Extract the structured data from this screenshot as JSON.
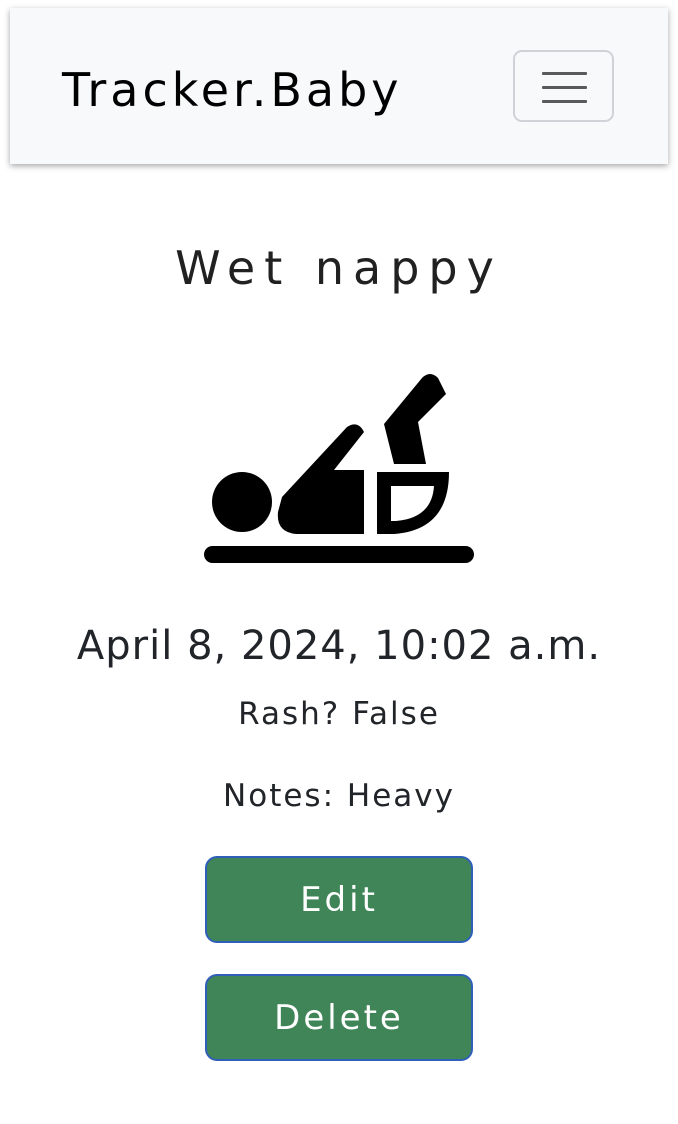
{
  "navbar": {
    "brand": "Tracker.Baby",
    "menu_icon": "hamburger-menu-icon"
  },
  "entry": {
    "title": "Wet nappy",
    "icon": "baby-changing-icon",
    "datetime": "April 8, 2024, 10:02 a.m.",
    "rash_label": "Rash? False",
    "notes_label": "Notes: Heavy"
  },
  "actions": {
    "edit_label": "Edit",
    "delete_label": "Delete"
  },
  "colors": {
    "button_bg": "#408557",
    "button_border": "#2f5fb8",
    "navbar_bg": "#f8f9fa"
  }
}
